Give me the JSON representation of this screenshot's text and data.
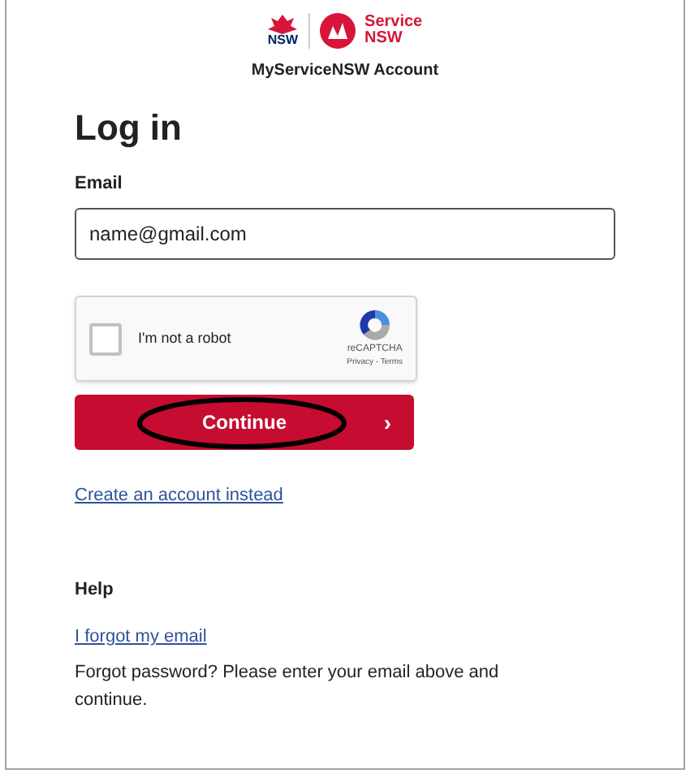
{
  "header": {
    "logo_left": "NSW",
    "logo_right": [
      "Service",
      "NSW"
    ],
    "title": "MyServiceNSW Account"
  },
  "heading": "Log in",
  "email": {
    "label": "Email",
    "value": "name@gmail.com"
  },
  "captcha": {
    "label": "I'm not a robot",
    "checked": false,
    "brand": "reCAPTCHA",
    "links": "Privacy - Terms"
  },
  "continue_button": {
    "label": "Continue",
    "arrow": "›",
    "circled": true
  },
  "create_link": "Create an account instead",
  "help": {
    "heading": "Help",
    "link": "I forgot my email",
    "text": "Forgot password? Please enter your email above and continue."
  }
}
